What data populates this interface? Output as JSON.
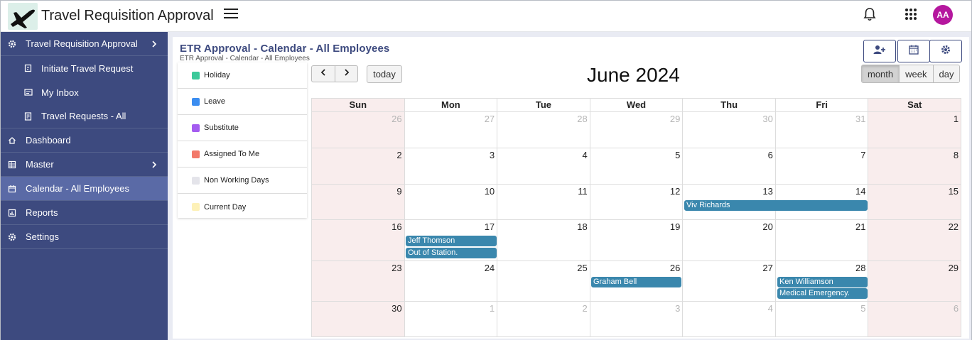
{
  "app": {
    "title": "Travel Requisition Approval",
    "avatar_initials": "AA",
    "avatar_color": "#b5179e"
  },
  "sidebar": {
    "items": [
      {
        "label": "Travel Requisition Approval",
        "icon": "gear-icon",
        "has_children": true
      },
      {
        "label": "Initiate Travel Request",
        "icon": "edit-doc-icon",
        "sub": true
      },
      {
        "label": "My Inbox",
        "icon": "inbox-icon",
        "sub": true
      },
      {
        "label": "Travel Requests - All",
        "icon": "list-doc-icon",
        "sub": true
      },
      {
        "label": "Dashboard",
        "icon": "home-icon"
      },
      {
        "label": "Master",
        "icon": "building-icon",
        "has_children": true
      },
      {
        "label": "Calendar - All Employees",
        "icon": "calendar-icon",
        "active": true
      },
      {
        "label": "Reports",
        "icon": "chart-icon"
      },
      {
        "label": "Settings",
        "icon": "gear-icon"
      }
    ]
  },
  "page": {
    "title": "ETR Approval - Calendar - All Employees",
    "breadcrumb": "ETR Approval - Calendar - All Employees"
  },
  "legend": [
    {
      "label": "Holiday",
      "color": "#3cc99a"
    },
    {
      "label": "Leave",
      "color": "#3b8df0"
    },
    {
      "label": "Substitute",
      "color": "#a45cf0"
    },
    {
      "label": "Assigned To Me",
      "color": "#f2796a"
    },
    {
      "label": "Non Working Days",
      "color": "#e4e4ea"
    },
    {
      "label": "Current Day",
      "color": "#fdf1b8"
    }
  ],
  "calendar": {
    "title": "June 2024",
    "today_label": "today",
    "views": [
      "month",
      "week",
      "day"
    ],
    "active_view": "month",
    "dow": [
      "Sun",
      "Mon",
      "Tue",
      "Wed",
      "Thu",
      "Fri",
      "Sat"
    ],
    "weeks": [
      [
        "26",
        "27",
        "28",
        "29",
        "30",
        "31",
        "1"
      ],
      [
        "2",
        "3",
        "4",
        "5",
        "6",
        "7",
        "8"
      ],
      [
        "9",
        "10",
        "11",
        "12",
        "13",
        "14",
        "15"
      ],
      [
        "16",
        "17",
        "18",
        "19",
        "20",
        "21",
        "22"
      ],
      [
        "23",
        "24",
        "25",
        "26",
        "27",
        "28",
        "29"
      ],
      [
        "30",
        "1",
        "2",
        "3",
        "4",
        "5",
        "6"
      ]
    ],
    "events": [
      {
        "title": "Viv Richards"
      },
      {
        "title": "Jeff Thomson"
      },
      {
        "title": "Out of Station."
      },
      {
        "title": "Graham Bell"
      },
      {
        "title": "Ken Williamson"
      },
      {
        "title": "Medical Emergency."
      }
    ]
  }
}
